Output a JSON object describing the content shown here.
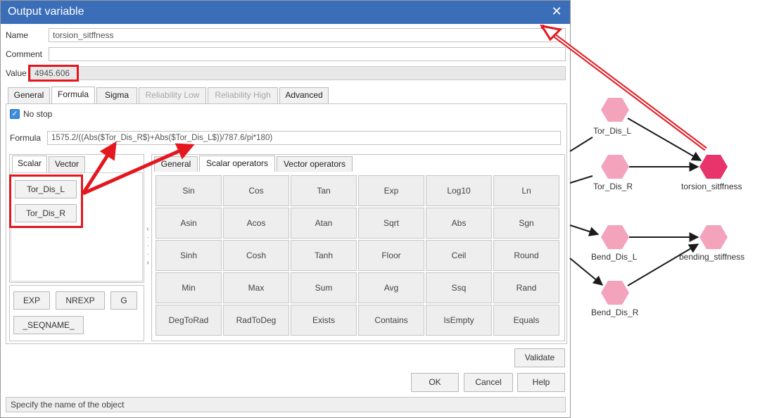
{
  "window": {
    "title": "Output variable",
    "close_glyph": "✕"
  },
  "fields": {
    "name_label": "Name",
    "name_value": "torsion_sitffness",
    "comment_label": "Comment",
    "comment_value": "",
    "value_label": "Value",
    "value_value": "4945.606"
  },
  "tabs": [
    {
      "label": "General",
      "state": "normal"
    },
    {
      "label": "Formula",
      "state": "active"
    },
    {
      "label": "Sigma",
      "state": "normal"
    },
    {
      "label": "Reliability Low",
      "state": "disabled"
    },
    {
      "label": "Reliability High",
      "state": "disabled"
    },
    {
      "label": "Advanced",
      "state": "normal"
    }
  ],
  "formula": {
    "nostop_label": "No stop",
    "nostop_checked": true,
    "formula_label": "Formula",
    "formula_value": "1575.2/((Abs($Tor_Dis_R$)+Abs($Tor_Dis_L$))/787.6/pi*180)"
  },
  "var_tabs": [
    {
      "label": "Scalar",
      "state": "active"
    },
    {
      "label": "Vector",
      "state": "normal"
    }
  ],
  "variables": [
    "Tor_Dis_L",
    "Tor_Dis_R"
  ],
  "constants": {
    "row1": [
      "EXP",
      "NREXP",
      "G"
    ],
    "row2": [
      "_SEQNAME_"
    ]
  },
  "op_tabs": [
    {
      "label": "General",
      "state": "normal"
    },
    {
      "label": "Scalar operators",
      "state": "active"
    },
    {
      "label": "Vector operators",
      "state": "normal"
    }
  ],
  "operators": [
    [
      "Sin",
      "Cos",
      "Tan",
      "Exp",
      "Log10",
      "Ln"
    ],
    [
      "Asin",
      "Acos",
      "Atan",
      "Sqrt",
      "Abs",
      "Sgn"
    ],
    [
      "Sinh",
      "Cosh",
      "Tanh",
      "Floor",
      "Ceil",
      "Round"
    ],
    [
      "Min",
      "Max",
      "Sum",
      "Avg",
      "Ssq",
      "Rand"
    ],
    [
      "DegToRad",
      "RadToDeg",
      "Exists",
      "Contains",
      "IsEmpty",
      "Equals"
    ]
  ],
  "buttons": {
    "validate": "Validate",
    "ok": "OK",
    "cancel": "Cancel",
    "help": "Help"
  },
  "status_text": "Specify the name of the object",
  "graph": {
    "nodes": [
      {
        "id": "tor_l",
        "label": "Tor_Dis_L"
      },
      {
        "id": "tor_r",
        "label": "Tor_Dis_R"
      },
      {
        "id": "torsion",
        "label": "torsion_sitffness"
      },
      {
        "id": "bend_l",
        "label": "Bend_Dis_L"
      },
      {
        "id": "bend_r",
        "label": "Bend_Dis_R"
      },
      {
        "id": "bending",
        "label": "bending_stiffness"
      }
    ]
  },
  "colors": {
    "titlebar": "#3b6eb8",
    "highlight": "#e4161e",
    "node_input": "#f4a3bd",
    "node_output": "#e8336b",
    "checkbox": "#3a8ee0"
  }
}
